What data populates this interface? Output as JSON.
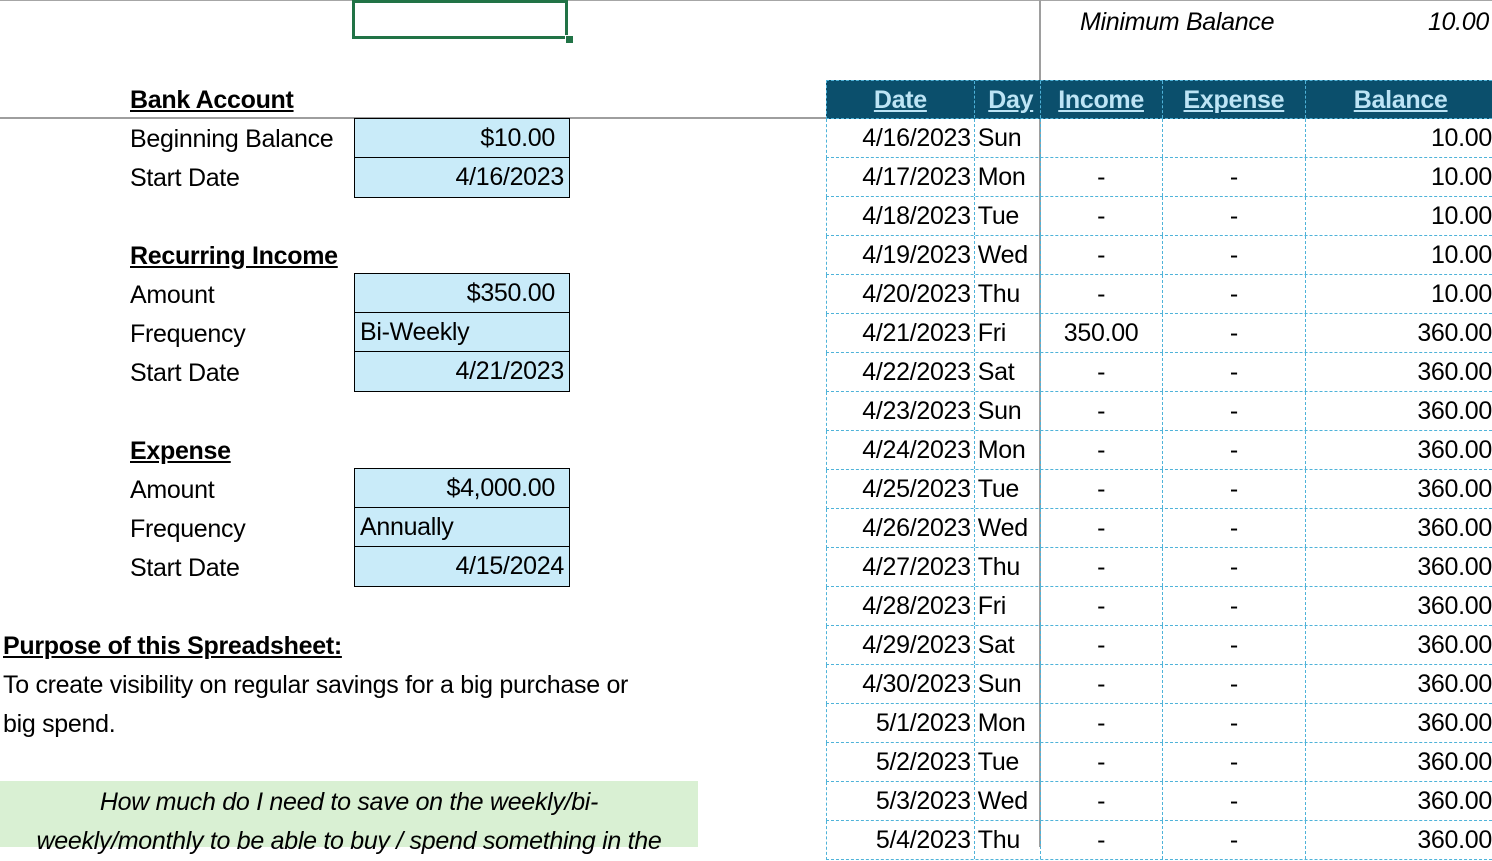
{
  "summary": {
    "min_balance_label": "Minimum Balance",
    "min_balance_value": "10.00"
  },
  "bank_account": {
    "title": "Bank Account",
    "beginning_balance_label": "Beginning Balance",
    "beginning_balance_value": "$10.00",
    "start_date_label": "Start Date",
    "start_date_value": "4/16/2023"
  },
  "recurring_income": {
    "title": "Recurring Income",
    "amount_label": "Amount",
    "amount_value": "$350.00",
    "frequency_label": "Frequency",
    "frequency_value": "Bi-Weekly",
    "start_date_label": "Start Date",
    "start_date_value": "4/21/2023"
  },
  "expense": {
    "title": "Expense",
    "amount_label": "Amount",
    "amount_value": "$4,000.00",
    "frequency_label": "Frequency",
    "frequency_value": "Annually",
    "start_date_label": "Start Date",
    "start_date_value": "4/15/2024"
  },
  "purpose": {
    "title": "Purpose of this Spreadsheet:",
    "line1": "To create visibility on regular savings for a big purchase or",
    "line2": "big spend.",
    "question_line1": "How much do I need to save on the weekly/bi-",
    "question_line2": "weekly/monthly to be able to buy / spend something in the"
  },
  "colors": {
    "header_bg": "#0b4f6c",
    "header_text": "#bde4f5",
    "input_bg": "#c9ebf9",
    "note_bg": "#d9f0d3",
    "selection": "#217346",
    "grid_dash": "#4fb3d9"
  },
  "ledger": {
    "headers": [
      "Date",
      "Day",
      "Income",
      "Expense",
      "Balance"
    ],
    "rows": [
      [
        "4/16/2023",
        "Sun",
        "",
        "",
        "10.00"
      ],
      [
        "4/17/2023",
        "Mon",
        "-",
        "-",
        "10.00"
      ],
      [
        "4/18/2023",
        "Tue",
        "-",
        "-",
        "10.00"
      ],
      [
        "4/19/2023",
        "Wed",
        "-",
        "-",
        "10.00"
      ],
      [
        "4/20/2023",
        "Thu",
        "-",
        "-",
        "10.00"
      ],
      [
        "4/21/2023",
        "Fri",
        "350.00",
        "-",
        "360.00"
      ],
      [
        "4/22/2023",
        "Sat",
        "-",
        "-",
        "360.00"
      ],
      [
        "4/23/2023",
        "Sun",
        "-",
        "-",
        "360.00"
      ],
      [
        "4/24/2023",
        "Mon",
        "-",
        "-",
        "360.00"
      ],
      [
        "4/25/2023",
        "Tue",
        "-",
        "-",
        "360.00"
      ],
      [
        "4/26/2023",
        "Wed",
        "-",
        "-",
        "360.00"
      ],
      [
        "4/27/2023",
        "Thu",
        "-",
        "-",
        "360.00"
      ],
      [
        "4/28/2023",
        "Fri",
        "-",
        "-",
        "360.00"
      ],
      [
        "4/29/2023",
        "Sat",
        "-",
        "-",
        "360.00"
      ],
      [
        "4/30/2023",
        "Sun",
        "-",
        "-",
        "360.00"
      ],
      [
        "5/1/2023",
        "Mon",
        "-",
        "-",
        "360.00"
      ],
      [
        "5/2/2023",
        "Tue",
        "-",
        "-",
        "360.00"
      ],
      [
        "5/3/2023",
        "Wed",
        "-",
        "-",
        "360.00"
      ],
      [
        "5/4/2023",
        "Thu",
        "-",
        "-",
        "360.00"
      ]
    ]
  }
}
